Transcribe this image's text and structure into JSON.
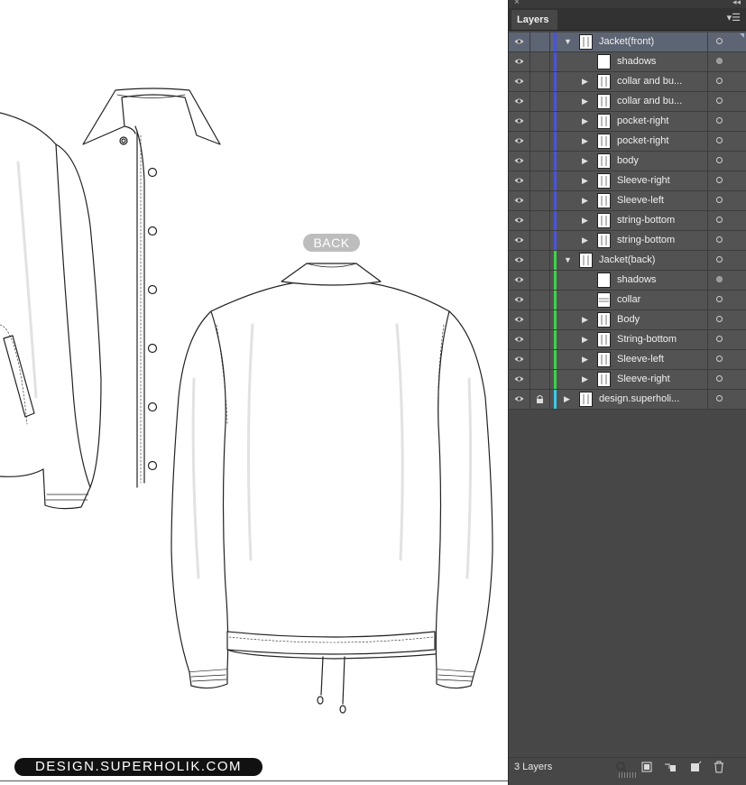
{
  "canvas": {
    "back_label": "BACK",
    "brand_label": "DESIGN.SUPERHOLIK.COM"
  },
  "panel": {
    "title": "Layers",
    "footer_count": "3 Layers",
    "colors": {
      "front_group": "#4a55d8",
      "back_group": "#3ed24a",
      "design_layer": "#3fc8e6",
      "selection": "#5d6574"
    },
    "footer_icons": [
      "locate-object-icon",
      "make-clipping-mask-icon",
      "create-sublayer-icon",
      "create-new-layer-icon",
      "delete-layer-icon"
    ]
  },
  "layers": [
    {
      "name": "Jacket(front)",
      "level": 0,
      "expanded": true,
      "has_children": true,
      "selected": true,
      "target_filled": false,
      "color": "front",
      "locked": false
    },
    {
      "name": "shadows",
      "level": 1,
      "has_children": false,
      "target_filled": true,
      "color": "front"
    },
    {
      "name": "collar and bu...",
      "level": 1,
      "has_children": true,
      "target_filled": false,
      "color": "front"
    },
    {
      "name": "collar and bu...",
      "level": 1,
      "has_children": true,
      "target_filled": false,
      "color": "front"
    },
    {
      "name": "pocket-right",
      "level": 1,
      "has_children": true,
      "target_filled": false,
      "color": "front"
    },
    {
      "name": "pocket-right",
      "level": 1,
      "has_children": true,
      "target_filled": false,
      "color": "front"
    },
    {
      "name": "body",
      "level": 1,
      "has_children": true,
      "target_filled": false,
      "color": "front"
    },
    {
      "name": "Sleeve-right",
      "level": 1,
      "has_children": true,
      "target_filled": false,
      "color": "front"
    },
    {
      "name": "Sleeve-left",
      "level": 1,
      "has_children": true,
      "target_filled": false,
      "color": "front"
    },
    {
      "name": "string-bottom",
      "level": 1,
      "has_children": true,
      "target_filled": false,
      "color": "front"
    },
    {
      "name": "string-bottom",
      "level": 1,
      "has_children": true,
      "target_filled": false,
      "color": "front"
    },
    {
      "name": "Jacket(back)",
      "level": 0,
      "expanded": true,
      "has_children": true,
      "selected": false,
      "target_filled": false,
      "color": "back",
      "locked": false
    },
    {
      "name": "shadows",
      "level": 1,
      "has_children": false,
      "target_filled": true,
      "color": "back"
    },
    {
      "name": "collar",
      "level": 1,
      "has_children": false,
      "target_filled": false,
      "color": "back"
    },
    {
      "name": "Body",
      "level": 1,
      "has_children": true,
      "target_filled": false,
      "color": "back"
    },
    {
      "name": "String-bottom",
      "level": 1,
      "has_children": true,
      "target_filled": false,
      "color": "back"
    },
    {
      "name": "Sleeve-left",
      "level": 1,
      "has_children": true,
      "target_filled": false,
      "color": "back"
    },
    {
      "name": "Sleeve-right",
      "level": 1,
      "has_children": true,
      "target_filled": false,
      "color": "back"
    },
    {
      "name": "design.superholi...",
      "level": 0,
      "expanded": false,
      "has_children": true,
      "selected": false,
      "target_filled": false,
      "color": "design",
      "locked": true
    }
  ]
}
